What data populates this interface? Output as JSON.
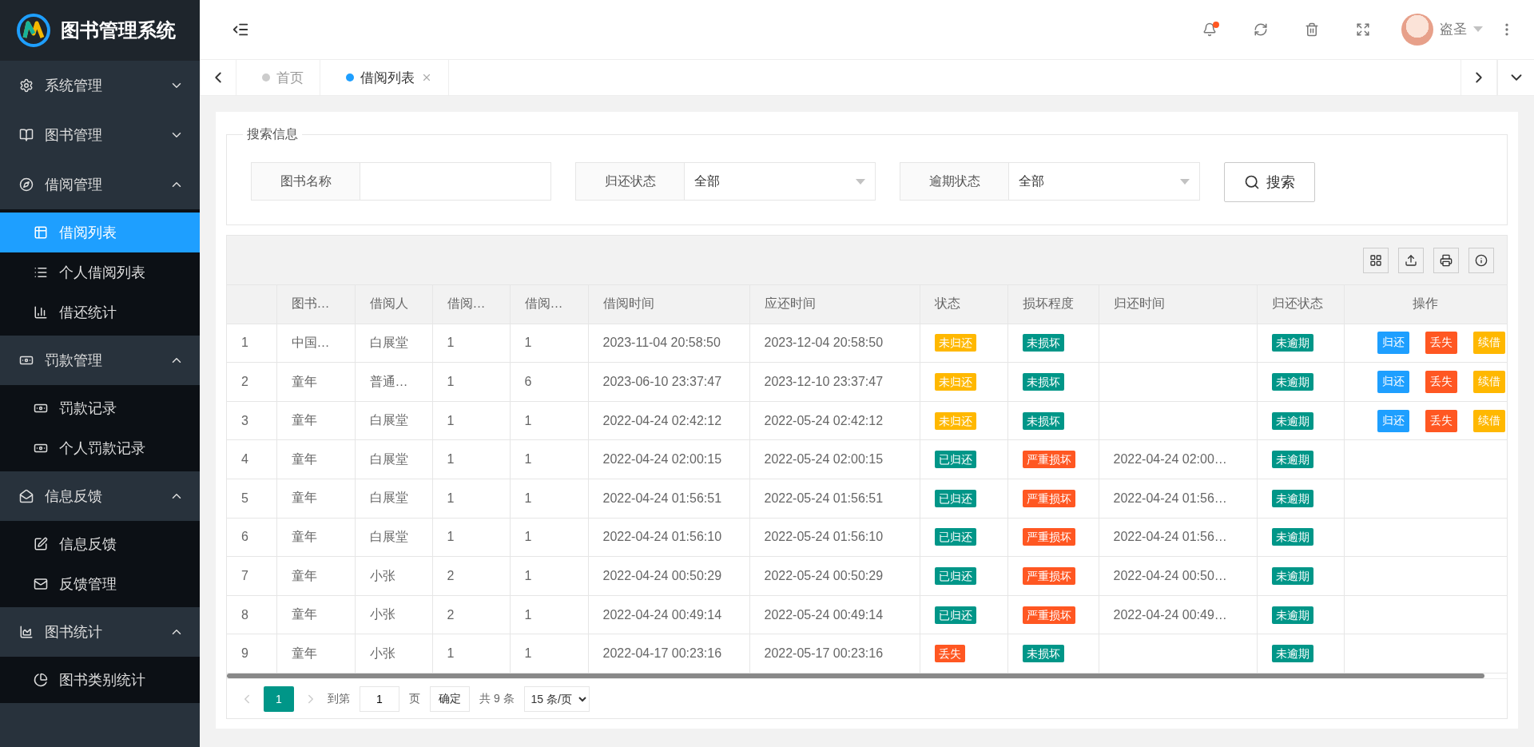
{
  "sidebar": {
    "title": "图书管理系统",
    "groups": [
      {
        "label": "系统管理",
        "expanded": false
      },
      {
        "label": "图书管理",
        "expanded": false
      },
      {
        "label": "借阅管理",
        "expanded": true,
        "children": [
          {
            "label": "借阅列表",
            "selected": true
          },
          {
            "label": "个人借阅列表",
            "selected": false
          },
          {
            "label": "借还统计",
            "selected": false
          }
        ]
      },
      {
        "label": "罚款管理",
        "expanded": true,
        "children": [
          {
            "label": "罚款记录",
            "selected": false
          },
          {
            "label": "个人罚款记录",
            "selected": false
          }
        ]
      },
      {
        "label": "信息反馈",
        "expanded": true,
        "children": [
          {
            "label": "信息反馈",
            "selected": false
          },
          {
            "label": "反馈管理",
            "selected": false
          }
        ]
      },
      {
        "label": "图书统计",
        "expanded": true,
        "children": [
          {
            "label": "图书类别统计",
            "selected": false
          }
        ]
      }
    ]
  },
  "header": {
    "notification_unread": true,
    "user": "盗圣"
  },
  "tabs": [
    {
      "label": "首页",
      "selected": false,
      "closable": false
    },
    {
      "label": "借阅列表",
      "selected": true,
      "closable": true
    }
  ],
  "search": {
    "legend": "搜索信息",
    "fields": [
      {
        "kind": "text",
        "label": "图书名称"
      },
      {
        "kind": "select",
        "label": "归还状态",
        "value": "全部"
      },
      {
        "kind": "select",
        "label": "逾期状态",
        "value": "全部"
      }
    ],
    "button": "搜索"
  },
  "table": {
    "columns": [
      "图书…",
      "借阅人",
      "借阅…",
      "借阅…",
      "借阅时间",
      "应还时间",
      "状态",
      "损坏程度",
      "归还时间",
      "归还状态",
      "操作"
    ],
    "rows": [
      {
        "no": "1",
        "book": "中国…",
        "borrower": "白展堂",
        "col_4": "1",
        "col_5": "1",
        "borrow_time": "2023-11-04 20:58:50",
        "due_time": "2023-12-04 20:58:50",
        "status": {
          "text": "未归还",
          "color": "#ffb800"
        },
        "damage": {
          "text": "未损坏",
          "color": "#009688"
        },
        "overdue": {
          "text": "未逾期",
          "color": "#009688"
        },
        "actions": [
          {
            "label": "归还",
            "color": "#1e9fff"
          },
          {
            "label": "丢失",
            "color": "#ff5722"
          },
          {
            "label": "续借",
            "color": "#ffb800"
          }
        ]
      },
      {
        "no": "2",
        "book": "童年",
        "borrower": "普通…",
        "col_4": "1",
        "col_5": "6",
        "borrow_time": "2023-06-10 23:37:47",
        "due_time": "2023-12-10 23:37:47",
        "status": {
          "text": "未归还",
          "color": "#ffb800"
        },
        "damage": {
          "text": "未损坏",
          "color": "#009688"
        },
        "overdue": {
          "text": "未逾期",
          "color": "#009688"
        },
        "actions": [
          {
            "label": "归还",
            "color": "#1e9fff"
          },
          {
            "label": "丢失",
            "color": "#ff5722"
          },
          {
            "label": "续借",
            "color": "#ffb800"
          }
        ]
      },
      {
        "no": "3",
        "book": "童年",
        "borrower": "白展堂",
        "col_4": "1",
        "col_5": "1",
        "borrow_time": "2022-04-24 02:42:12",
        "due_time": "2022-05-24 02:42:12",
        "status": {
          "text": "未归还",
          "color": "#ffb800"
        },
        "damage": {
          "text": "未损坏",
          "color": "#009688"
        },
        "overdue": {
          "text": "未逾期",
          "color": "#009688"
        },
        "actions": [
          {
            "label": "归还",
            "color": "#1e9fff"
          },
          {
            "label": "丢失",
            "color": "#ff5722"
          },
          {
            "label": "续借",
            "color": "#ffb800"
          }
        ]
      },
      {
        "no": "4",
        "book": "童年",
        "borrower": "白展堂",
        "col_4": "1",
        "col_5": "1",
        "borrow_time": "2022-04-24 02:00:15",
        "due_time": "2022-05-24 02:00:15",
        "status": {
          "text": "已归还",
          "color": "#009688"
        },
        "damage": {
          "text": "严重损坏",
          "color": "#ff5722"
        },
        "return_time": "2022-04-24 02:00…",
        "overdue": {
          "text": "未逾期",
          "color": "#009688"
        }
      },
      {
        "no": "5",
        "book": "童年",
        "borrower": "白展堂",
        "col_4": "1",
        "col_5": "1",
        "borrow_time": "2022-04-24 01:56:51",
        "due_time": "2022-05-24 01:56:51",
        "status": {
          "text": "已归还",
          "color": "#009688"
        },
        "damage": {
          "text": "严重损坏",
          "color": "#ff5722"
        },
        "return_time": "2022-04-24 01:56…",
        "overdue": {
          "text": "未逾期",
          "color": "#009688"
        }
      },
      {
        "no": "6",
        "book": "童年",
        "borrower": "白展堂",
        "col_4": "1",
        "col_5": "1",
        "borrow_time": "2022-04-24 01:56:10",
        "due_time": "2022-05-24 01:56:10",
        "status": {
          "text": "已归还",
          "color": "#009688"
        },
        "damage": {
          "text": "严重损坏",
          "color": "#ff5722"
        },
        "return_time": "2022-04-24 01:56…",
        "overdue": {
          "text": "未逾期",
          "color": "#009688"
        }
      },
      {
        "no": "7",
        "book": "童年",
        "borrower": "小张",
        "col_4": "2",
        "col_5": "1",
        "borrow_time": "2022-04-24 00:50:29",
        "due_time": "2022-05-24 00:50:29",
        "status": {
          "text": "已归还",
          "color": "#009688"
        },
        "damage": {
          "text": "严重损坏",
          "color": "#ff5722"
        },
        "return_time": "2022-04-24 00:50…",
        "overdue": {
          "text": "未逾期",
          "color": "#009688"
        }
      },
      {
        "no": "8",
        "book": "童年",
        "borrower": "小张",
        "col_4": "2",
        "col_5": "1",
        "borrow_time": "2022-04-24 00:49:14",
        "due_time": "2022-05-24 00:49:14",
        "status": {
          "text": "已归还",
          "color": "#009688"
        },
        "damage": {
          "text": "严重损坏",
          "color": "#ff5722"
        },
        "return_time": "2022-04-24 00:49…",
        "overdue": {
          "text": "未逾期",
          "color": "#009688"
        }
      },
      {
        "no": "9",
        "book": "童年",
        "borrower": "小张",
        "col_4": "1",
        "col_5": "1",
        "borrow_time": "2022-04-17 00:23:16",
        "due_time": "2022-05-17 00:23:16",
        "status": {
          "text": "丢失",
          "color": "#ff5722"
        },
        "damage": {
          "text": "未损坏",
          "color": "#009688"
        },
        "overdue": {
          "text": "未逾期",
          "color": "#009688"
        }
      }
    ]
  },
  "pager": {
    "pages": [
      {
        "label": "1",
        "selected": true
      }
    ],
    "goto_label": "到第",
    "goto_value": "1",
    "page_unit": "页",
    "confirm": "确定",
    "total": "共 9 条",
    "page_size": "15 条/页"
  }
}
